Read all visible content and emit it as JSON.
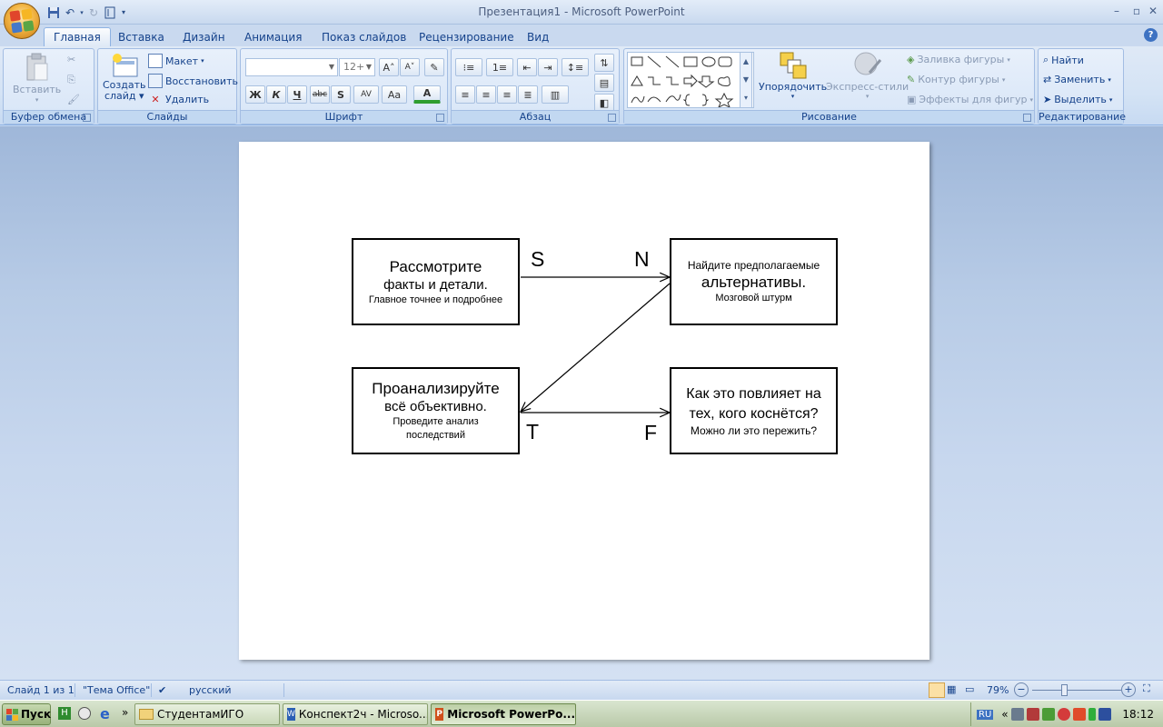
{
  "window": {
    "title": "Презентация1 - Microsoft PowerPoint"
  },
  "tabs": [
    "Главная",
    "Вставка",
    "Дизайн",
    "Анимация",
    "Показ слайдов",
    "Рецензирование",
    "Вид"
  ],
  "active_tab": "Главная",
  "ribbon": {
    "clipboard": {
      "label": "Буфер обмена",
      "paste": "Вставить"
    },
    "slides": {
      "label": "Слайды",
      "new_slide_line1": "Создать",
      "new_slide_line2": "слайд",
      "layout": "Макет",
      "reset": "Восстановить",
      "delete": "Удалить"
    },
    "font": {
      "label": "Шрифт",
      "font_name": "",
      "font_size": "12+",
      "bold": "Ж",
      "italic": "К",
      "underline": "Ч",
      "strike": "abc",
      "shadow": "S",
      "spacing": "AV",
      "case": "Aa",
      "color": "A"
    },
    "paragraph": {
      "label": "Абзац"
    },
    "drawing": {
      "label": "Рисование",
      "arrange": "Упорядочить",
      "quick_styles": "Экспресс-стили",
      "shape_fill": "Заливка фигуры",
      "shape_outline": "Контур фигуры",
      "shape_effects": "Эффекты для фигур"
    },
    "editing": {
      "label": "Редактирование",
      "find": "Найти",
      "replace": "Заменить",
      "select": "Выделить"
    }
  },
  "slide": {
    "box_s": {
      "title": "Рассмотрите",
      "line2": "факты и детали.",
      "line3": "Главное точнее и подробнее"
    },
    "box_n": {
      "line1": "Найдите предполагаемые",
      "title": "альтернативы.",
      "line3": "Мозговой штурм"
    },
    "box_t": {
      "title": "Проанализируйте",
      "line2": "всё объективно.",
      "line3": "Проведите анализ",
      "line4": "последствий"
    },
    "box_f": {
      "line1": "Как это повлияет на",
      "line2": "тех, кого коснётся?",
      "line3": "Можно ли это пережить?"
    },
    "letters": {
      "s": "S",
      "n": "N",
      "t": "T",
      "f": "F"
    }
  },
  "statusbar": {
    "slide_info": "Слайд 1 из 1",
    "theme": "\"Тема Office\"",
    "language": "русский",
    "zoom": "79%"
  },
  "taskbar": {
    "start": "Пуск",
    "tasks": [
      "СтудентамИГО",
      "Конспект2ч - Microso...",
      "Microsoft PowerPo..."
    ],
    "active_task_index": 2,
    "language": "RU",
    "clock": "18:12"
  }
}
